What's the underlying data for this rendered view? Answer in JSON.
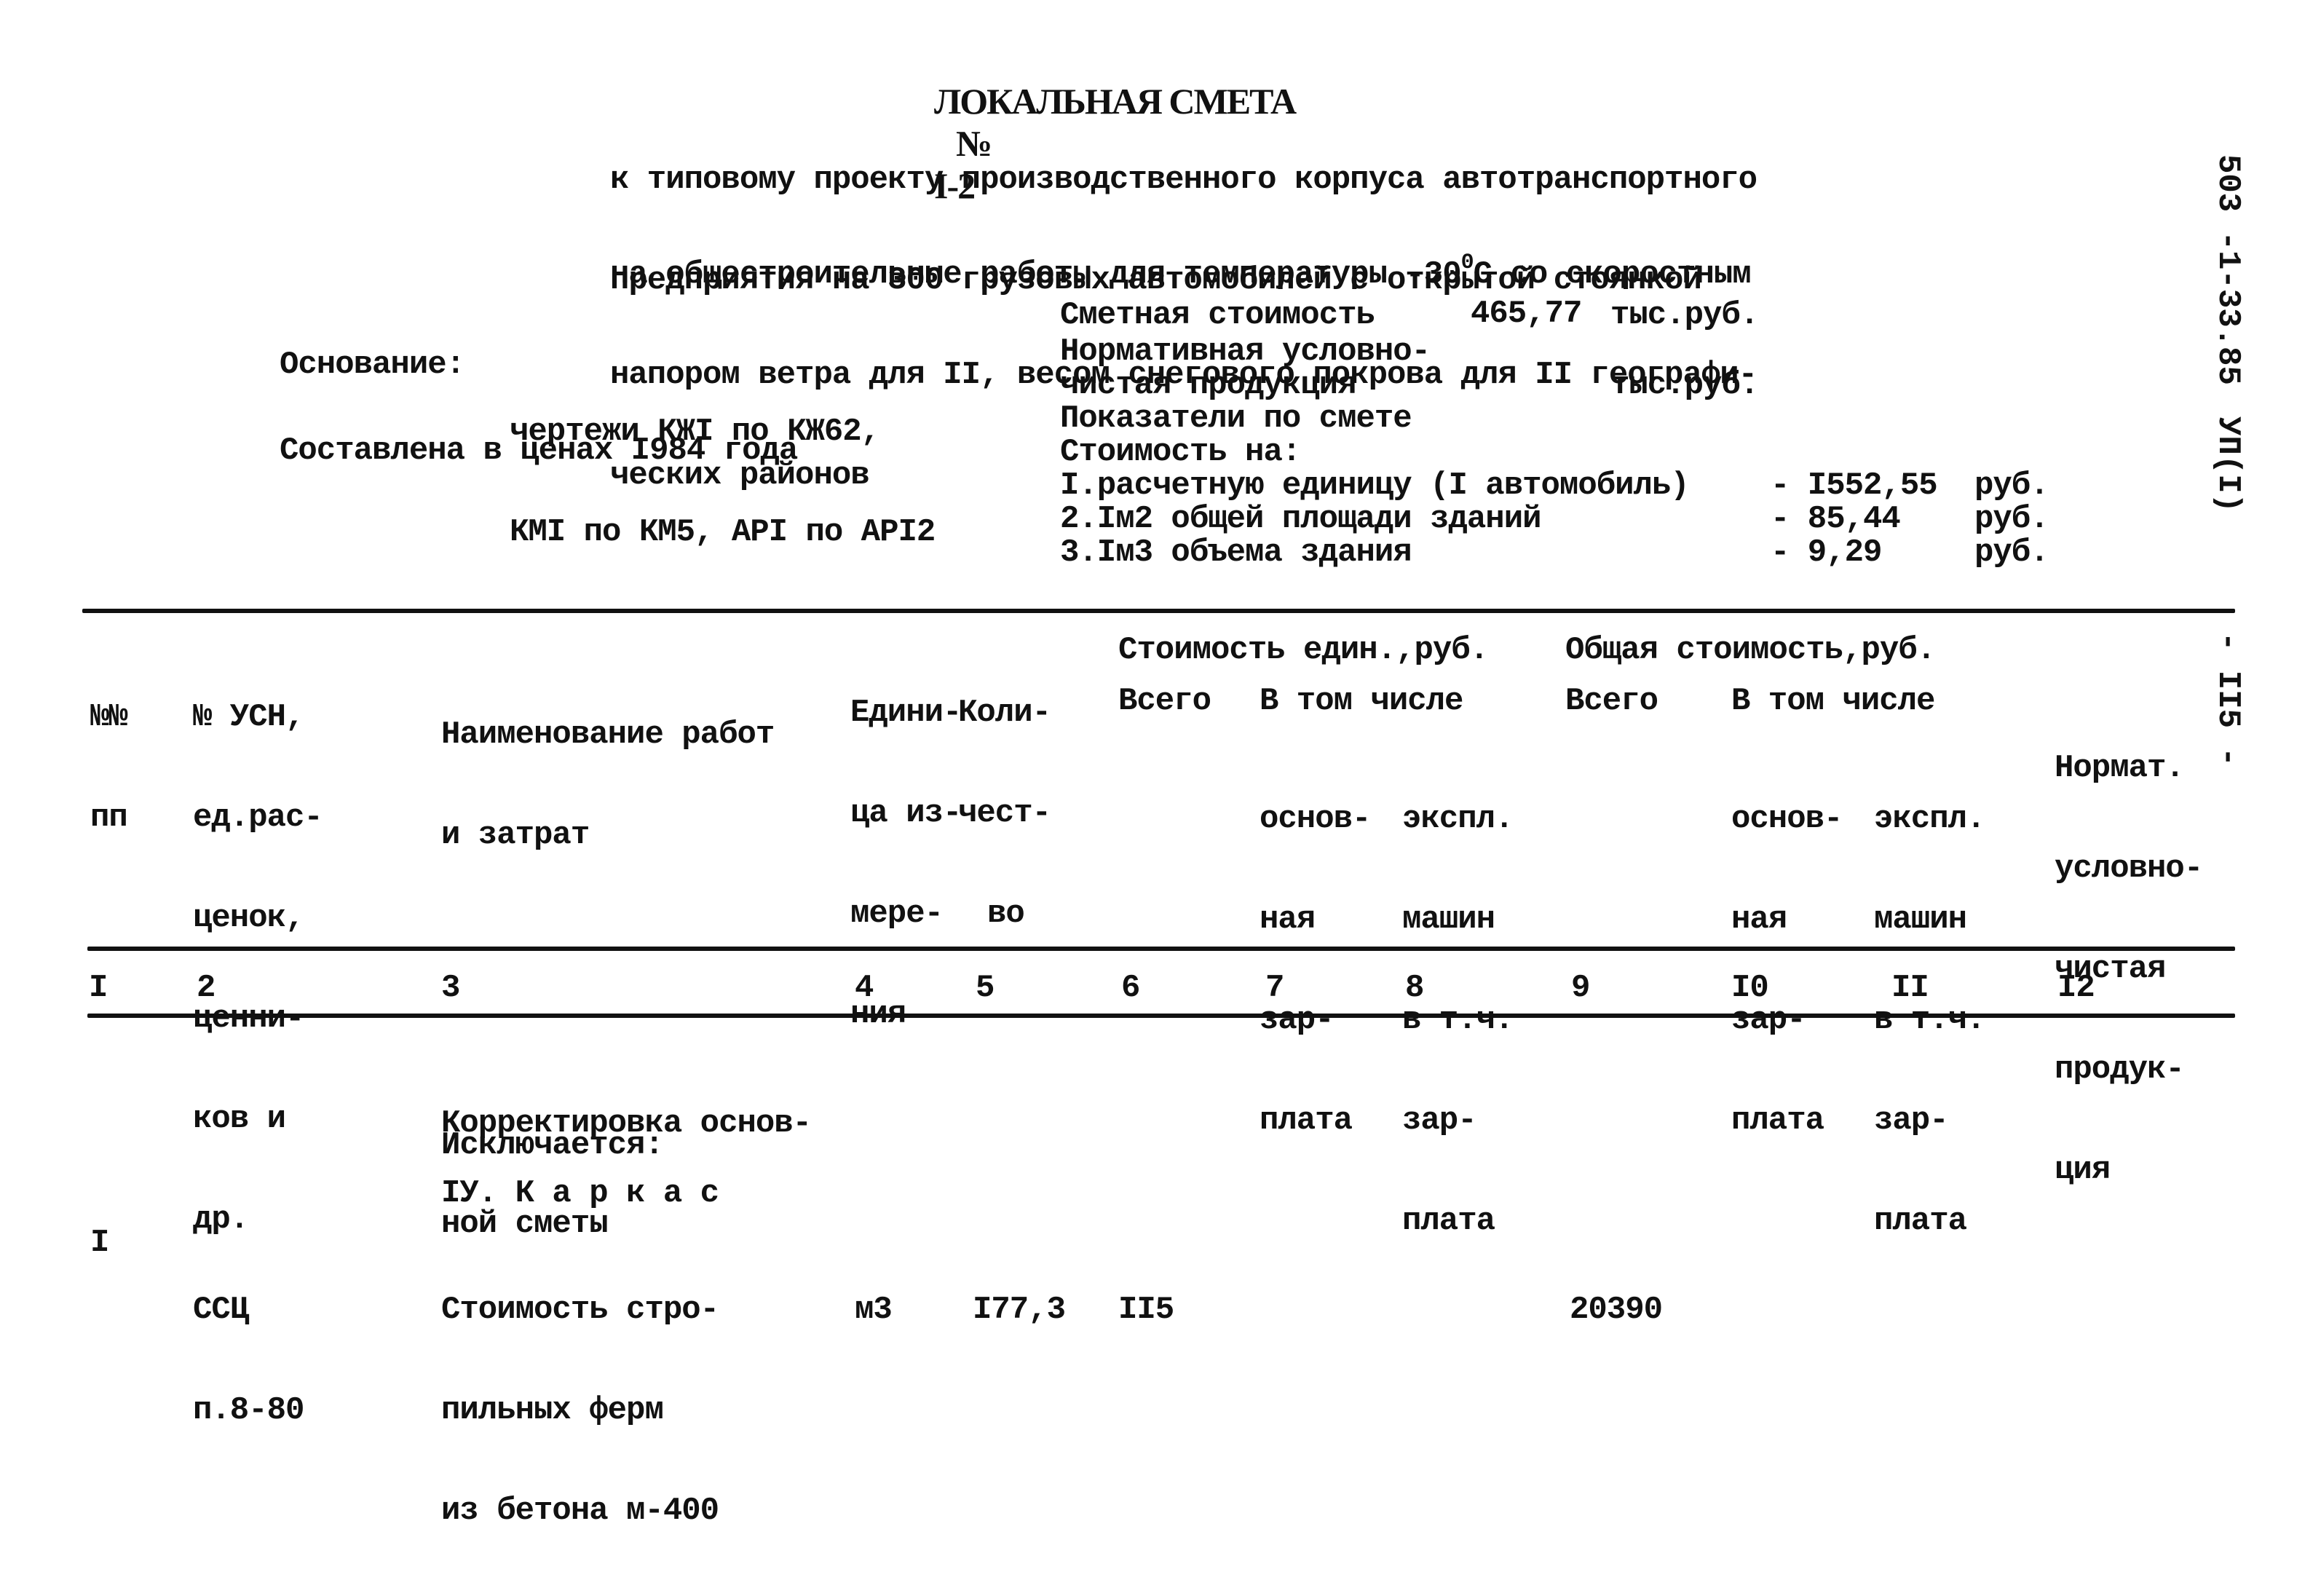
{
  "header": {
    "title": "ЛОКАЛЬНАЯ СМЕТА",
    "number_sign": "№",
    "number": "I-2",
    "subtitle_lines": [
      "к типовому проекту производственного корпуса автотранспортного",
      "предприятия на 300 грузовых автомобилей с открытой стоянкой"
    ],
    "scope_line1_pre": "на общестроительные работы для температуры -30",
    "scope_line1_sup": "0",
    "scope_line1_post": "С со скоростным",
    "scope_lines": [
      "напором ветра для II, весом снегового покрова для II географи-",
      "ческих районов"
    ]
  },
  "basis": {
    "label": "Основание:",
    "lines": [
      "чертежи КЖI по КЖ62,",
      "КМI по КМ5, АРI по АРI2"
    ],
    "prices": "Составлена в ценах I984 года"
  },
  "summary": {
    "estimated_cost_label": "Сметная стоимость",
    "estimated_cost_value": "465,77",
    "estimated_cost_unit": "тыс.руб.",
    "normative_label_1": "Нормативная условно-",
    "normative_label_2": "чистая продукция",
    "normative_unit": "тыс.руб.",
    "indicators_label": "Показатели по смете",
    "cost_per_label": "Стоимость на:",
    "indicators": [
      {
        "label": "I.расчетную единицу (I автомобиль)",
        "value": "- I552,55",
        "unit": "руб."
      },
      {
        "label": "2.Iм2 общей площади зданий",
        "value": "- 85,44",
        "unit": "руб."
      },
      {
        "label": "3.Iм3 объема здания",
        "value": "- 9,29",
        "unit": "руб."
      }
    ]
  },
  "margin": {
    "doc_code": "503 -1-33.85",
    "album": "УП(I)",
    "page": "- II5 -"
  },
  "table": {
    "headers": {
      "c1": [
        "№№",
        "пп"
      ],
      "c2": [
        "№ УСН,",
        "ед.рас-",
        "ценок,",
        "ценни-",
        "ков и",
        "др."
      ],
      "c3": [
        "Наименование работ",
        "и затрат"
      ],
      "c4": [
        "Едини-",
        "ца из-",
        "мере-",
        "ния"
      ],
      "c5": [
        "Коли-",
        "чест-",
        "во"
      ],
      "unit_cost_group": "Стоимость един.,руб.",
      "total_cost_group": "Общая стоимость,руб.",
      "total": "Всего",
      "incl": "В том числе",
      "base_wage": [
        "основ-",
        "ная",
        "зар-",
        "плата"
      ],
      "machines": [
        "экспл.",
        "машин",
        "в т.ч.",
        "зар-",
        "плата"
      ],
      "c12": [
        "Нормат.",
        "условно-",
        "чистая",
        "продук-",
        "ция"
      ]
    },
    "column_numbers": [
      "I",
      "2",
      "3",
      "4",
      "5",
      "6",
      "7",
      "8",
      "9",
      "I0",
      "II",
      "I2"
    ],
    "section_lines": [
      "Корректировка основ-",
      "ной сметы"
    ],
    "excluded_label": "Исключается:",
    "section_title": "IУ. К а р к а с",
    "rows": [
      {
        "num": "I",
        "code": [
          "ССЦ",
          "п.8-80"
        ],
        "name": [
          "Стоимость стро-",
          "пильных ферм",
          "из бетона м-400"
        ],
        "unit": "м3",
        "qty": "I77,3",
        "unit_total": "II5",
        "unit_base_wage": "",
        "unit_machines": "",
        "total": "20390",
        "total_base_wage": "",
        "total_machines": "",
        "normative": ""
      }
    ]
  }
}
